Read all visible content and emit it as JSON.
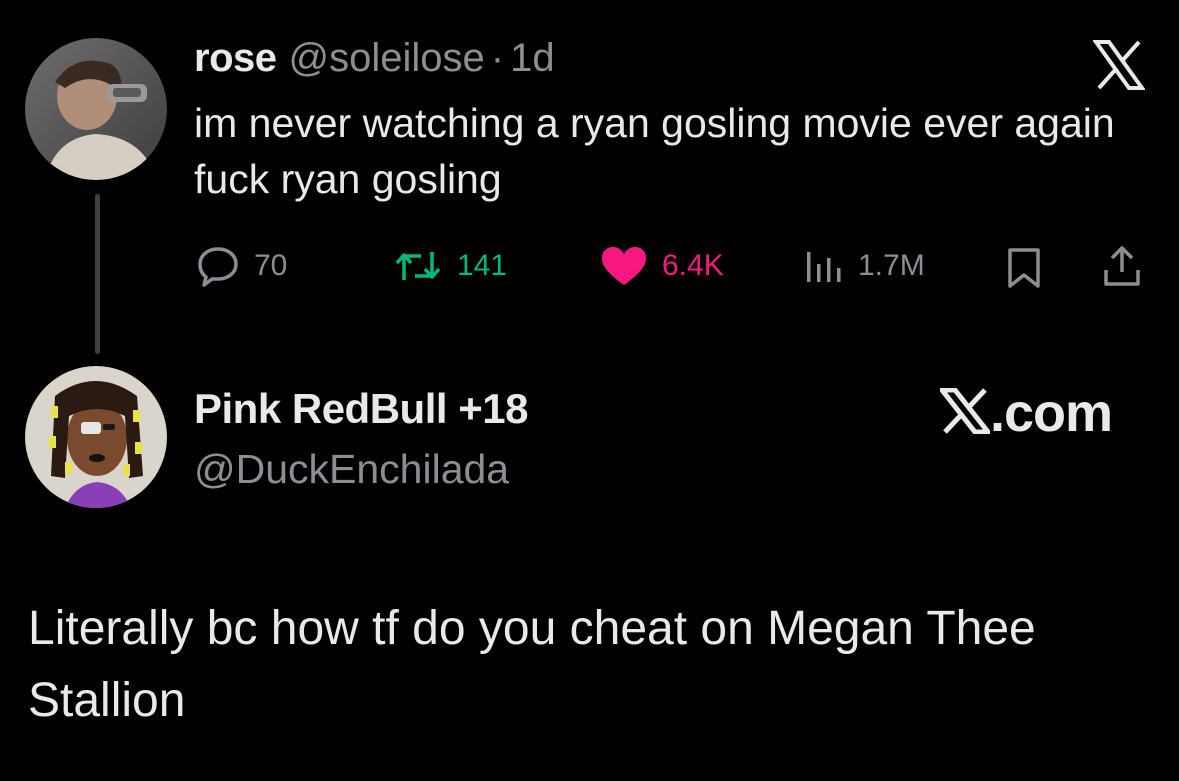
{
  "original_tweet": {
    "display_name": "rose",
    "handle": "@soleilose",
    "separator": "·",
    "time_ago": "1d",
    "text": "im never watching a ryan gosling movie ever again fuck ryan gosling",
    "actions": {
      "replies": "70",
      "retweets": "141",
      "likes": "6.4K",
      "views": "1.7M"
    },
    "platform_icon": "x-logo-icon"
  },
  "reply_tweet": {
    "display_name": "Pink RedBull +18",
    "handle": "@DuckEnchilada",
    "text": "Literally bc how tf do you cheat on Megan Thee Stallion",
    "brand_suffix": ".com"
  },
  "colors": {
    "background": "#000000",
    "primary_text": "#e7e9ea",
    "secondary_text": "#8b8f94",
    "retweet_green": "#00ba7c",
    "like_pink": "#f91880"
  }
}
